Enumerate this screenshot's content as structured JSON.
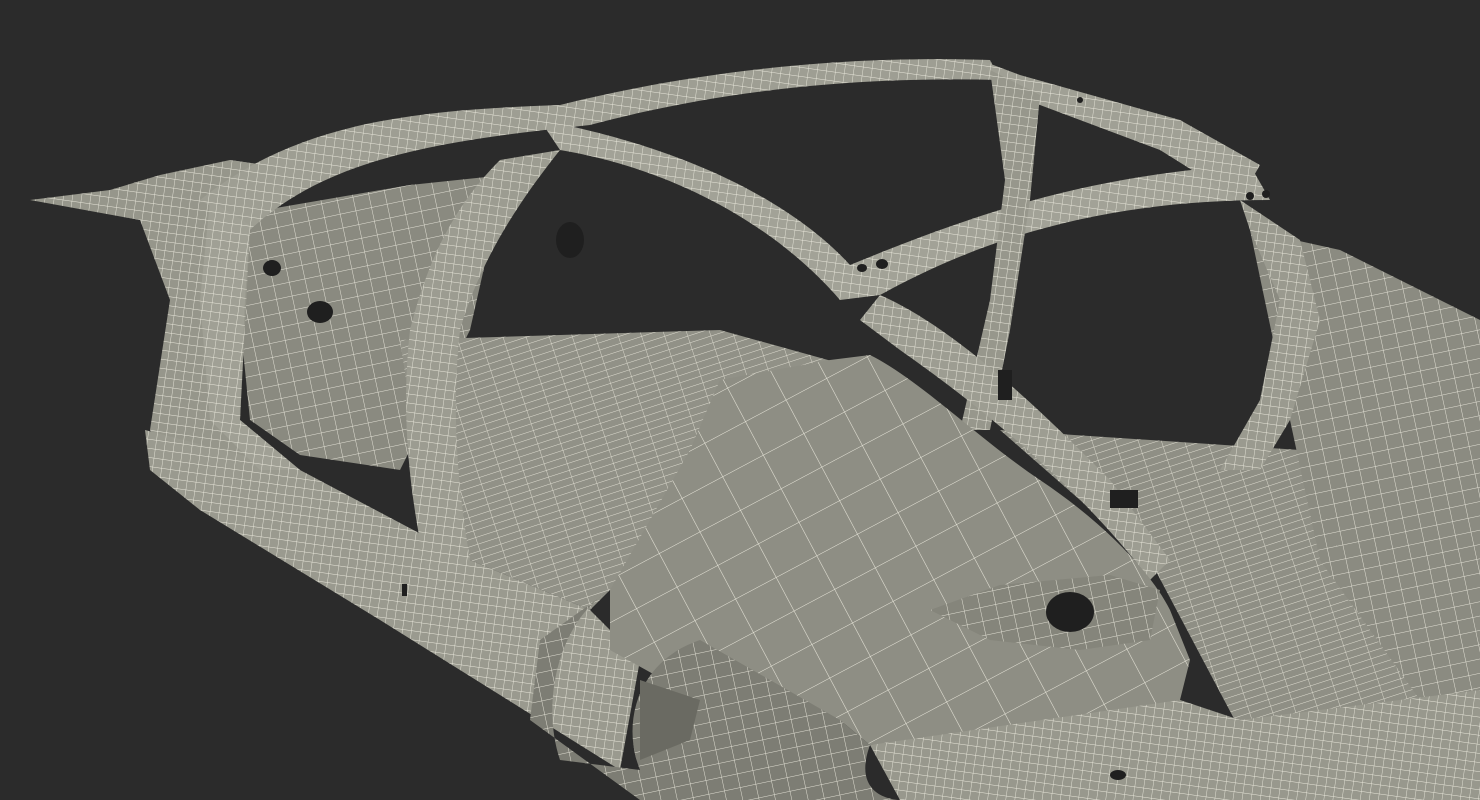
{
  "scene": {
    "subject": "car-body-in-white",
    "render_style": "wireframe-over-shaded",
    "colors": {
      "background": "#2b2b2b",
      "surface": "#8e8e84",
      "surface_shadow": "#6f6f67",
      "surface_light": "#a7a79c",
      "wire": "#f2f0e4",
      "hole": "#1f1f1f"
    }
  }
}
